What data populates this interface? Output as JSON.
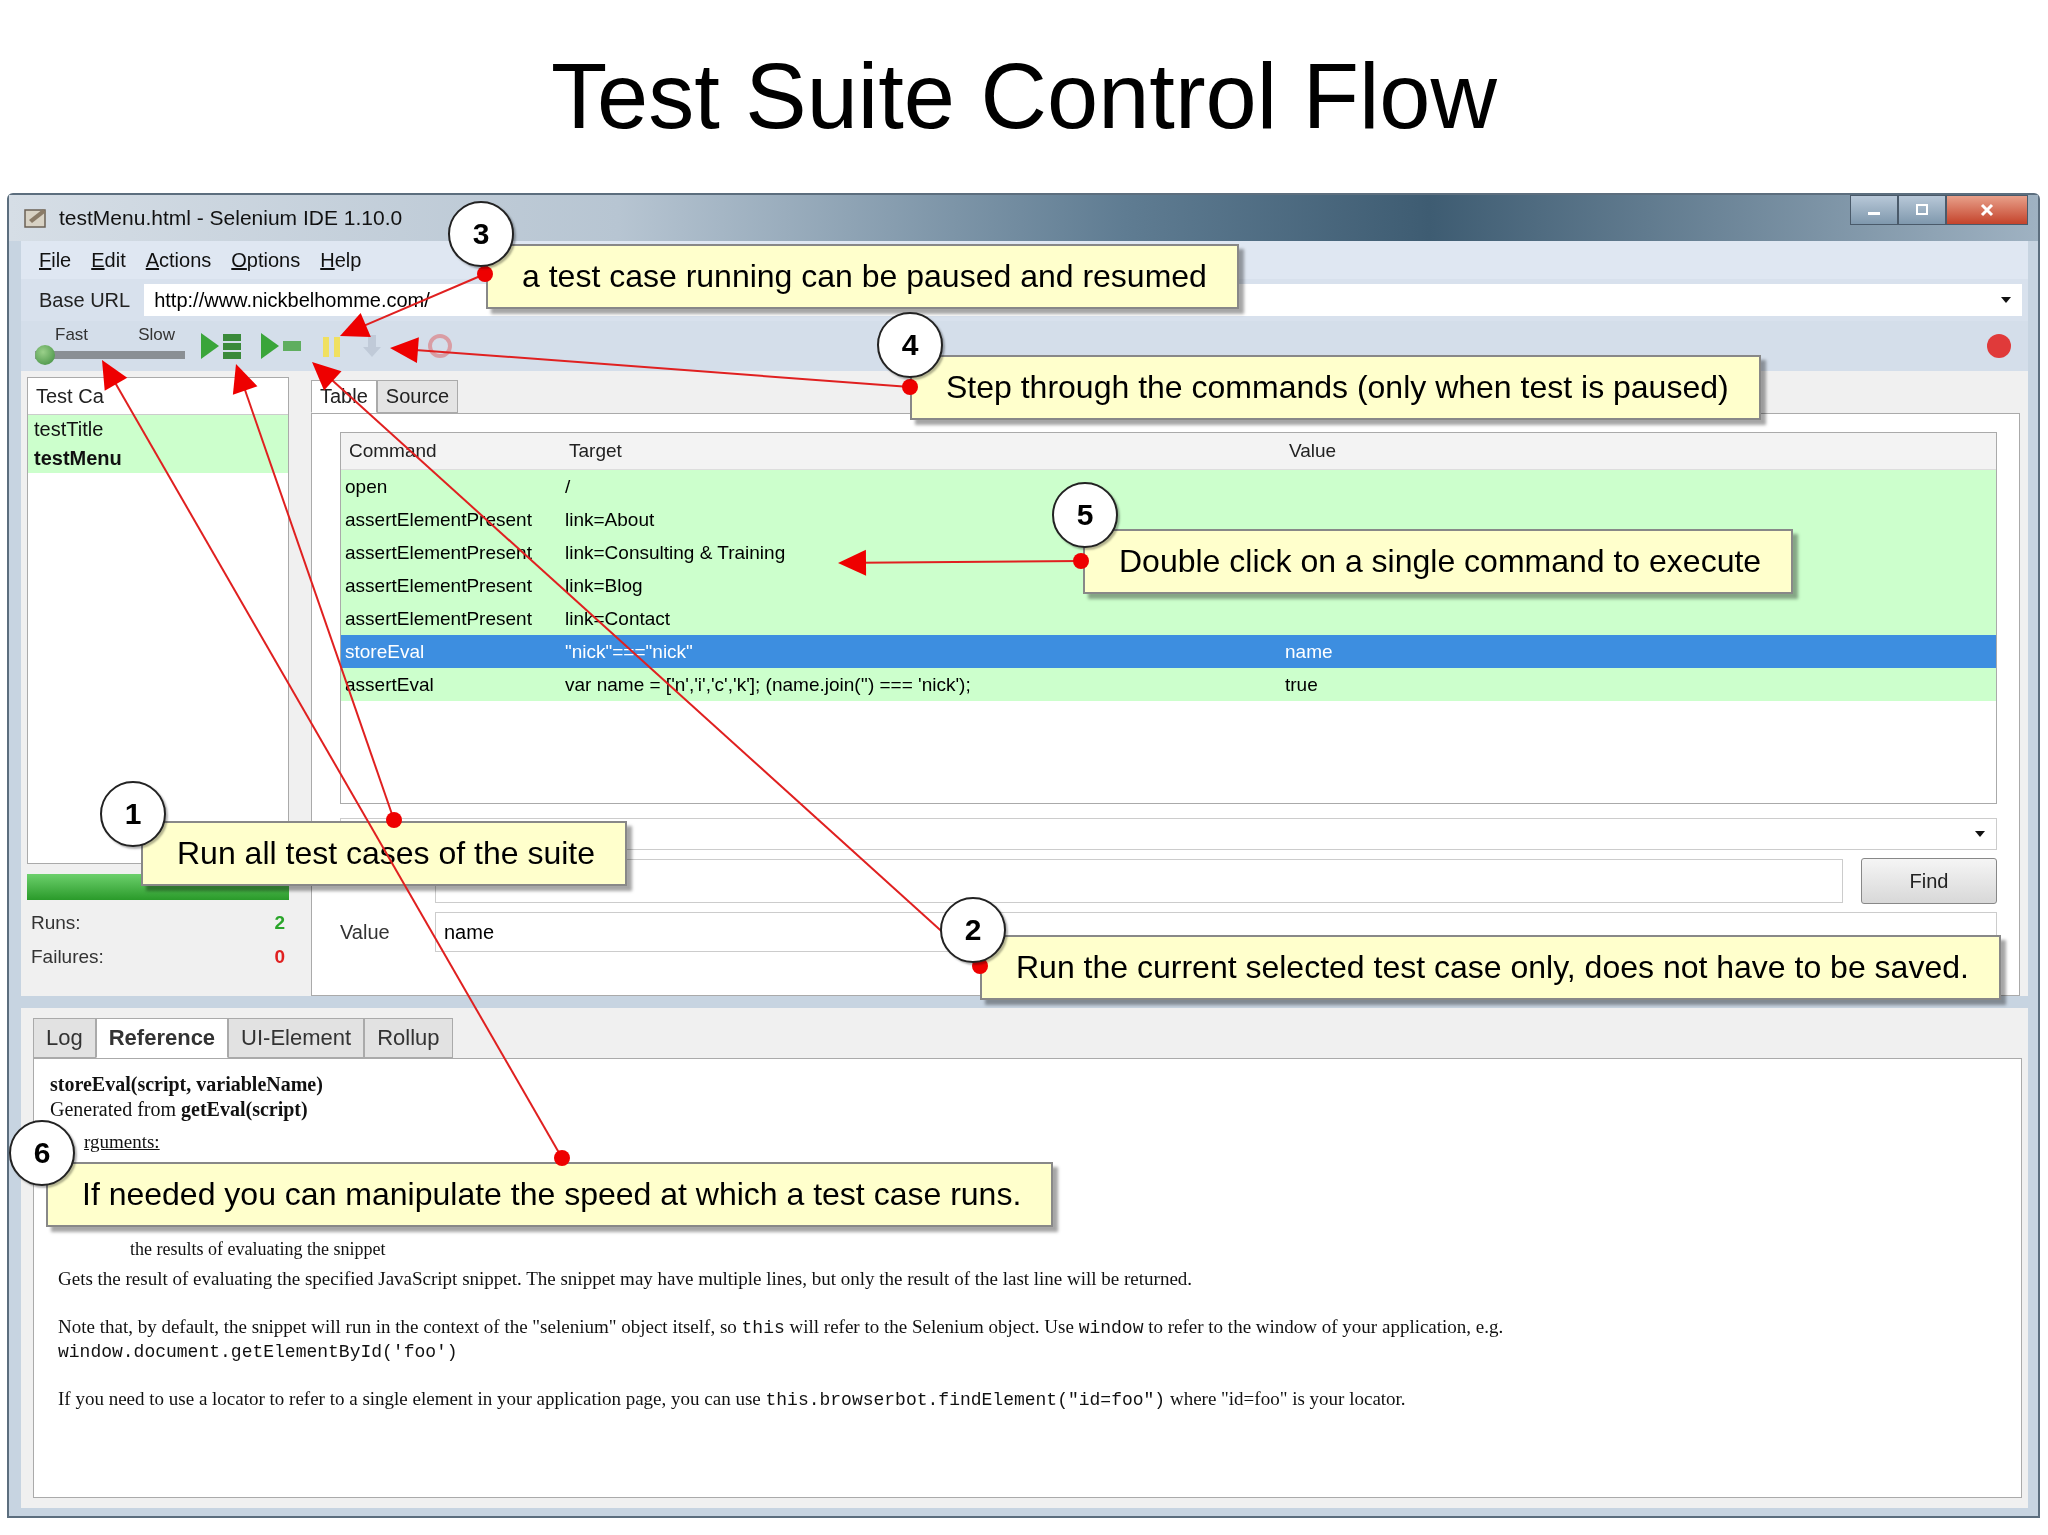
{
  "slide_title": "Test Suite Control Flow",
  "window": {
    "title": "testMenu.html - Selenium IDE 1.10.0"
  },
  "menu": [
    "File",
    "Edit",
    "Actions",
    "Options",
    "Help"
  ],
  "base_url": {
    "label": "Base URL",
    "value": "http://www.nickbelhomme.com/"
  },
  "toolbar": {
    "speed_labels": [
      "Fast",
      "Slow"
    ],
    "speed": {
      "level": 0
    },
    "buttons": [
      {
        "kind": "run-all",
        "disabled": false
      },
      {
        "kind": "run-one",
        "disabled": false
      },
      {
        "kind": "pause",
        "disabled": false
      },
      {
        "kind": "step",
        "disabled": true
      },
      {
        "kind": "rollup",
        "disabled": true
      }
    ]
  },
  "test_cases": {
    "header": "Test Ca",
    "items": [
      {
        "name": "testTitle",
        "selected": false
      },
      {
        "name": "testMenu",
        "selected": true
      }
    ],
    "progress": {
      "level": 1
    },
    "runs": {
      "label": "Runs:",
      "value": "2"
    },
    "failures": {
      "label": "Failures:",
      "value": "0"
    }
  },
  "editor_tabs": [
    {
      "label": "Table",
      "selected": true
    },
    {
      "label": "Source",
      "selected": false
    }
  ],
  "table": {
    "columns": [
      "Command",
      "Target",
      "Value"
    ],
    "rows": [
      {
        "cells": [
          "open",
          "/",
          ""
        ],
        "selected": false
      },
      {
        "cells": [
          "assertElementPresent",
          "link=About",
          ""
        ],
        "selected": false
      },
      {
        "cells": [
          "assertElementPresent",
          "link=Consulting & Training",
          ""
        ],
        "selected": false
      },
      {
        "cells": [
          "assertElementPresent",
          "link=Blog",
          ""
        ],
        "selected": false
      },
      {
        "cells": [
          "assertElementPresent",
          "link=Contact",
          ""
        ],
        "selected": false
      },
      {
        "cells": [
          "storeEval",
          "\"nick\"===\"nick\"",
          "name"
        ],
        "selected": true
      },
      {
        "cells": [
          "assertEval",
          "var name = ['n','i','c','k']; (name.join('') === 'nick');",
          "true"
        ],
        "selected": false
      }
    ]
  },
  "fields": {
    "find_button": "Find",
    "value_label": "Value",
    "value": "name"
  },
  "bottom_tabs": [
    {
      "label": "Log",
      "selected": false
    },
    {
      "label": "Reference",
      "selected": true
    },
    {
      "label": "UI-Element",
      "selected": false
    },
    {
      "label": "Rollup",
      "selected": false
    }
  ],
  "reference": {
    "signature": "storeEval(script, variableName)",
    "generated": "Generated from **getEval(script)**",
    "arguments": "rguments:",
    "returns": "the results of evaluating the snippet",
    "paragraphs": [
      [
        {
          "kind": "text",
          "text": "Gets the result of evaluating the specified JavaScript snippet. The snippet may have multiple lines, but only the result of the last line will be returned."
        }
      ],
      [
        {
          "kind": "text",
          "text": "Note that, by default, the snippet will run in the context of the \"selenium\" object itself, so "
        },
        {
          "kind": "code",
          "text": "this"
        },
        {
          "kind": "text",
          "text": " will refer to the Selenium object. Use "
        },
        {
          "kind": "code",
          "text": "window"
        },
        {
          "kind": "text",
          "text": " to refer to the window of your application, e.g."
        },
        {
          "kind": "code_line",
          "text": "window.document.getElementById('foo')"
        }
      ],
      [
        {
          "kind": "text",
          "text": "If you need to use a locator to refer to a single element in your application page, you can use "
        },
        {
          "kind": "code",
          "text": "this.browserbot.findElement(\"id=foo\")"
        },
        {
          "kind": "text",
          "text": " where \"id=foo\" is your locator."
        }
      ]
    ]
  },
  "callouts": [
    {
      "number": "3",
      "text": "a test case running can be paused and resumed"
    },
    {
      "number": "4",
      "text": "Step through the commands (only when test is paused)"
    },
    {
      "number": "5",
      "text": "Double click on a single command to execute"
    },
    {
      "number": "1",
      "text": "Run all test cases of the suite"
    },
    {
      "number": "2",
      "text": "Run the current selected test case only, does not have to be saved."
    },
    {
      "number": "6",
      "text": "If needed you can manipulate the speed at which a test case runs."
    }
  ]
}
